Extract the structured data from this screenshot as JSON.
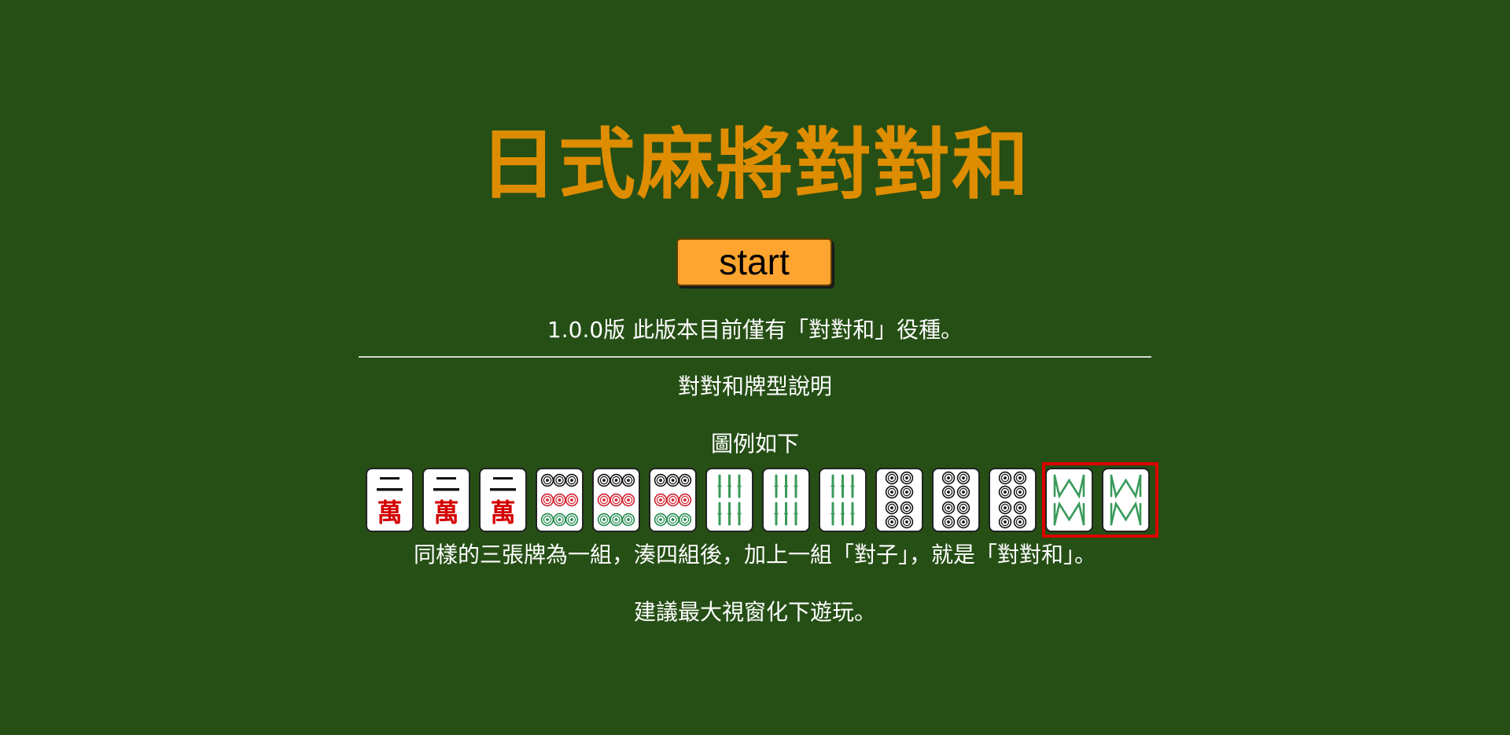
{
  "title": "日式麻將對對和",
  "start_button": {
    "label": "start"
  },
  "version_note": "1.0.0版 此版本目前僅有「對對和」役種。",
  "subheading": "對對和牌型說明",
  "example_label": "圖例如下",
  "example_hand": {
    "tiles": [
      {
        "name": "二萬",
        "suit": "man",
        "rank": 2
      },
      {
        "name": "二萬",
        "suit": "man",
        "rank": 2
      },
      {
        "name": "二萬",
        "suit": "man",
        "rank": 2
      },
      {
        "name": "9-pin",
        "suit": "pin",
        "rank": 9
      },
      {
        "name": "9-pin",
        "suit": "pin",
        "rank": 9
      },
      {
        "name": "9-pin",
        "suit": "pin",
        "rank": 9
      },
      {
        "name": "6-sou",
        "suit": "sou",
        "rank": 6
      },
      {
        "name": "6-sou",
        "suit": "sou",
        "rank": 6
      },
      {
        "name": "6-sou",
        "suit": "sou",
        "rank": 6
      },
      {
        "name": "8-pin",
        "suit": "pin",
        "rank": 8
      },
      {
        "name": "8-pin",
        "suit": "pin",
        "rank": 8
      },
      {
        "name": "8-pin",
        "suit": "pin",
        "rank": 8
      },
      {
        "name": "8-sou",
        "suit": "sou",
        "rank": 8
      },
      {
        "name": "8-sou",
        "suit": "sou",
        "rank": 8
      }
    ],
    "highlighted_pair": [
      12,
      13
    ]
  },
  "description": "同樣的三張牌為一組，湊四組後，加上一組「對子」，就是「對對和」。",
  "advice": "建議最大視窗化下遊玩。",
  "colors": {
    "background": "#264f16",
    "title": "#de8d00",
    "button": "#fea430",
    "highlight": "#dd0000",
    "man_red": "#d40000",
    "pin_red": "#d22030",
    "pin_green": "#1f8a4c",
    "sou_green": "#3a9a5a"
  }
}
